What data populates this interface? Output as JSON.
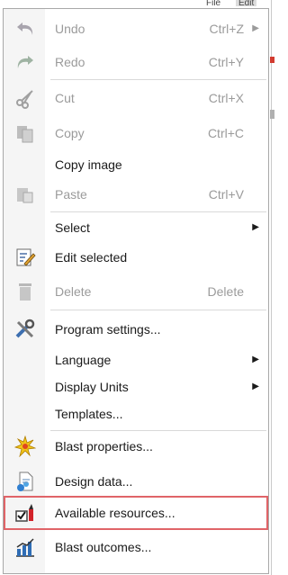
{
  "background_tabs": [
    "File",
    "Edit"
  ],
  "menu": {
    "items": [
      {
        "label": "Undo",
        "shortcut": "Ctrl+Z",
        "submenu": true,
        "enabled": false,
        "icon": "undo-icon"
      },
      {
        "label": "Redo",
        "shortcut": "Ctrl+Y",
        "enabled": false,
        "icon": "redo-icon"
      },
      {
        "label": "Cut",
        "shortcut": "Ctrl+X",
        "enabled": false,
        "icon": "scissors-icon"
      },
      {
        "label": "Copy",
        "shortcut": "Ctrl+C",
        "enabled": false,
        "icon": "copy-icon"
      },
      {
        "label": "Copy image",
        "enabled": true
      },
      {
        "label": "Paste",
        "shortcut": "Ctrl+V",
        "enabled": false,
        "icon": "paste-icon"
      },
      {
        "label": "Select",
        "submenu": true,
        "enabled": true
      },
      {
        "label": "Edit selected",
        "enabled": true,
        "icon": "edit-note-icon"
      },
      {
        "label": "Delete",
        "shortcut": "Delete",
        "enabled": false,
        "icon": "trash-icon"
      },
      {
        "label": "Program settings...",
        "enabled": true,
        "icon": "tools-icon"
      },
      {
        "label": "Language",
        "submenu": true,
        "enabled": true
      },
      {
        "label": "Display Units",
        "submenu": true,
        "enabled": true
      },
      {
        "label": "Templates...",
        "enabled": true
      },
      {
        "label": "Blast properties...",
        "enabled": true,
        "icon": "blast-icon"
      },
      {
        "label": "Design data...",
        "enabled": true,
        "icon": "design-data-icon"
      },
      {
        "label": "Available resources...",
        "enabled": true,
        "highlighted": true,
        "icon": "resources-icon"
      },
      {
        "label": "Blast outcomes...",
        "enabled": true,
        "icon": "chart-icon"
      }
    ],
    "submenu_glyph": "▶",
    "highlight_color": "#e06468"
  }
}
